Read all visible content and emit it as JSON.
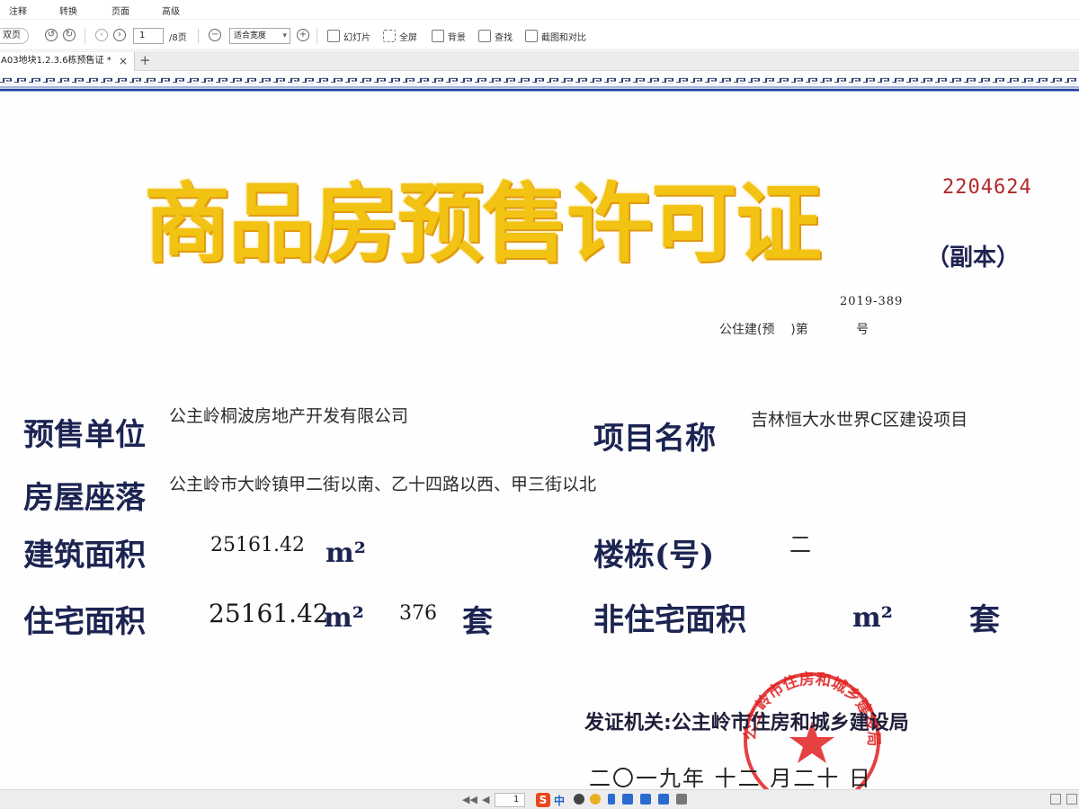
{
  "menu": [
    "注释",
    "转换",
    "页面",
    "高级"
  ],
  "toolbar": {
    "view_mode": "双页",
    "page_current": "1",
    "page_total": "/8页",
    "zoom": "适合宽度",
    "slideshow": "幻灯片",
    "fullscreen": "全屏",
    "background": "背景",
    "find": "查找",
    "screenshot_compare": "截图和对比"
  },
  "tab": {
    "title": "A03地块1.2.3.6栋预售证 *",
    "close": "×",
    "new": "+"
  },
  "certificate": {
    "number": "2204624",
    "title": "商品房预售许可证",
    "subtitle": "（副本）",
    "year_code": "2019-389",
    "doc_prefix": "公住建(预    )第            号",
    "labels": {
      "presale_unit": "预售单位",
      "project_name": "项目名称",
      "location": "房屋座落",
      "building_area": "建筑面积",
      "building_no": "楼栋(号)",
      "residential_area": "住宅面积",
      "non_residential_area": "非住宅面积"
    },
    "values": {
      "presale_unit": "公主岭桐波房地产开发有限公司",
      "project_name": "吉林恒大水世界C区建设项目",
      "location": "公主岭市大岭镇甲二街以南、乙十四路以西、甲三街以北",
      "building_area": "25161.42",
      "building_no": "二",
      "residential_area": "25161.42",
      "residential_units": "376"
    },
    "units": {
      "area": "m²",
      "sets": "套"
    },
    "issuer": "发证机关:公主岭市住房和城乡建设局",
    "issue_date": "二〇一九年  十二  月二十  日",
    "seal_text": "公主岭市住房和城乡建设局"
  },
  "statusbar": {
    "page": "1",
    "ime_logo": "S",
    "ime_lang": "中"
  },
  "colors": {
    "title_gold": "#f2c312",
    "label_navy": "#1c2452",
    "number_red": "#b02a2a",
    "seal_red": "#e02020",
    "border_blue": "#1f3fa0"
  }
}
